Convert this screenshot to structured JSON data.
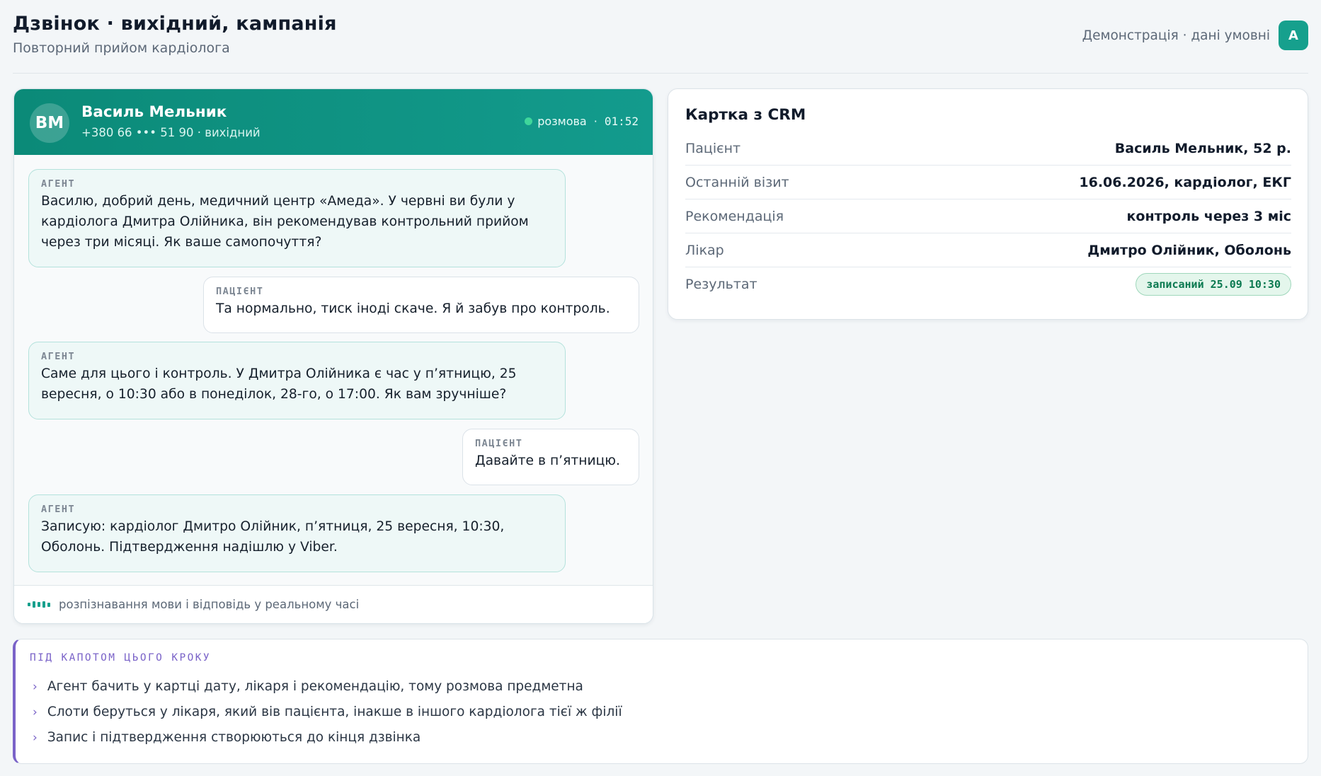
{
  "header": {
    "title": "Дзвінок · вихідний, кампанія",
    "subtitle": "Повторний прийом кардіолога",
    "demo_label": "Демонстрація · дані умовні",
    "user_initial": "A"
  },
  "call": {
    "caller_initials": "ВМ",
    "caller_name": "Василь Мельник",
    "caller_phone": "+380 66 ••• 51 90 · вихідний",
    "status": "розмова",
    "status_separator": "·",
    "timer": "01:52",
    "messages": [
      {
        "role": "АГЕНТ",
        "text": "Василю, добрий день, медичний центр «Амеда». У червні ви були у кардіолога Дмитра Олійника, він рекомендував контрольний прийом через три місяці. Як ваше самопочуття?"
      },
      {
        "role": "ПАЦІЄНТ",
        "text": "Та нормально, тиск іноді скаче. Я й забув про контроль."
      },
      {
        "role": "АГЕНТ",
        "text": "Саме для цього і контроль. У Дмитра Олійника є час у п’ятницю, 25 вересня, о 10:30 або в понеділок, 28-го, о 17:00. Як вам зручніше?"
      },
      {
        "role": "ПАЦІЄНТ",
        "text": "Давайте в п’ятницю."
      },
      {
        "role": "АГЕНТ",
        "text": "Записую: кардіолог Дмитро Олійник, п’ятниця, 25 вересня, 10:30, Оболонь. Підтвердження надішлю у Viber."
      }
    ],
    "footer_text": "розпізнавання мови і відповідь у реальному часі"
  },
  "crm": {
    "title": "Картка з CRM",
    "rows": [
      {
        "label": "Пацієнт",
        "value": "Василь Мельник, 52 р."
      },
      {
        "label": "Останній візит",
        "value": "16.06.2026, кардіолог, ЕКГ"
      },
      {
        "label": "Рекомендація",
        "value": "контроль через 3 міс"
      },
      {
        "label": "Лікар",
        "value": "Дмитро Олійник, Оболонь"
      },
      {
        "label": "Результат",
        "value": "записаний 25.09 10:30"
      }
    ]
  },
  "hood": {
    "title": "ПІД КАПОТОМ ЦЬОГО КРОКУ",
    "items": [
      "Агент бачить у картці дату, лікаря і рекомендацію, тому розмова предметна",
      "Слоти беруться у лікаря, який вів пацієнта, інакше в іншого кардіолога тієї ж філії",
      "Запис і підтвердження створюються до кінця дзвінка"
    ]
  },
  "colors": {
    "accent": "#16a08d",
    "call_header": "#0b8a78",
    "hood_accent": "#7a63c8",
    "status_live": "#3fd69b",
    "result_badge": "#0c7a51"
  },
  "icons": {
    "chevron": "chevron-right-icon",
    "wave": "audio-wave-icon",
    "status": "live-status-dot-icon"
  }
}
